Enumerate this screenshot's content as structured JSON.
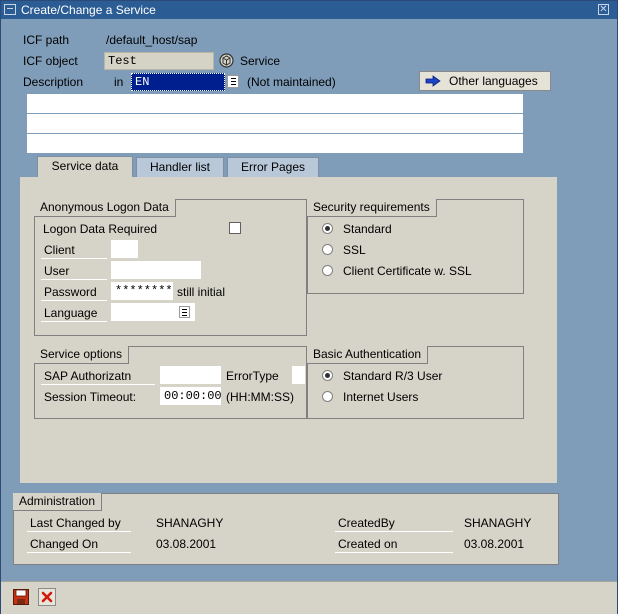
{
  "window": {
    "title": "Create/Change a Service"
  },
  "header": {
    "icf_path_label": "ICF path",
    "icf_path_value": "/default_host/sap",
    "icf_object_label": "ICF object",
    "icf_object_value": "Test",
    "object_type": "Service",
    "description_label": "Description",
    "in_label": "in",
    "language_value": "EN",
    "not_maintained": "(Not maintained)",
    "other_languages_button": "Other languages",
    "description_lines": [
      "",
      "",
      ""
    ]
  },
  "tabs": [
    {
      "label": "Service data",
      "active": true
    },
    {
      "label": "Handler list",
      "active": false
    },
    {
      "label": "Error Pages",
      "active": false
    }
  ],
  "anonymous_logon": {
    "title": "Anonymous Logon Data",
    "logon_required_label": "Logon Data Required",
    "logon_required_checked": false,
    "client_label": "Client",
    "client_value": "",
    "user_label": "User",
    "user_value": "",
    "password_label": "Password",
    "password_value": "********",
    "password_status": "still initial",
    "language_label": "Language",
    "language_value": ""
  },
  "security": {
    "title": "Security requirements",
    "options": [
      "Standard",
      "SSL",
      "Client Certificate w. SSL"
    ],
    "selected": "Standard"
  },
  "service_options": {
    "title": "Service options",
    "sap_auth_label": "SAP Authorizatn",
    "sap_auth_value": "",
    "error_type_label": "ErrorType",
    "error_type_value": "",
    "session_timeout_label": "Session Timeout:",
    "session_timeout_value": "00:00:00",
    "session_timeout_format": "(HH:MM:SS)"
  },
  "basic_auth": {
    "title": "Basic Authentication",
    "options": [
      "Standard R/3 User",
      "Internet Users"
    ],
    "selected": "Standard R/3 User"
  },
  "administration": {
    "title": "Administration",
    "last_changed_by_label": "Last Changed by",
    "last_changed_by_value": "SHANAGHY",
    "changed_on_label": "Changed On",
    "changed_on_value": "03.08.2001",
    "created_by_label": "CreatedBy",
    "created_by_value": "SHANAGHY",
    "created_on_label": "Created on",
    "created_on_value": "03.08.2001"
  },
  "toolbar": {
    "save_icon": "save-icon",
    "cancel_icon": "cancel-icon"
  },
  "colors": {
    "titlebar": "#2b5d94",
    "background": "#7f9db9",
    "panel": "#d6d3c8",
    "selection": "#001f8f"
  }
}
